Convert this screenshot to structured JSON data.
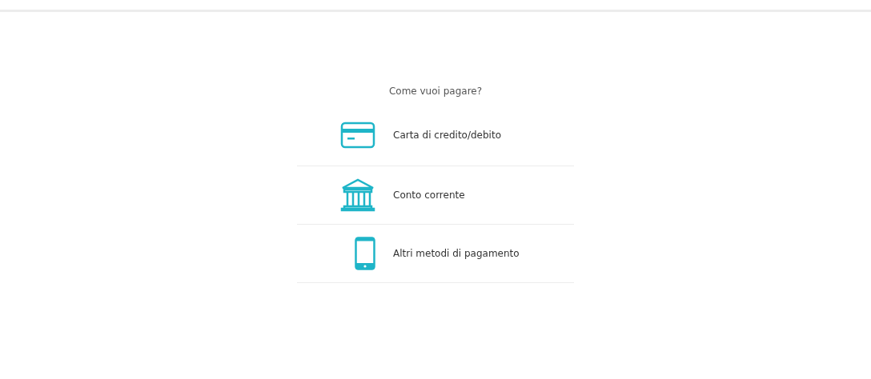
{
  "question": "Come vuoi pagare?",
  "methods": [
    {
      "kind": "card",
      "label": "Carta di credito/debito"
    },
    {
      "kind": "bank",
      "label": "Conto corrente"
    },
    {
      "kind": "phone",
      "label": "Altri metodi di pagamento"
    }
  ]
}
